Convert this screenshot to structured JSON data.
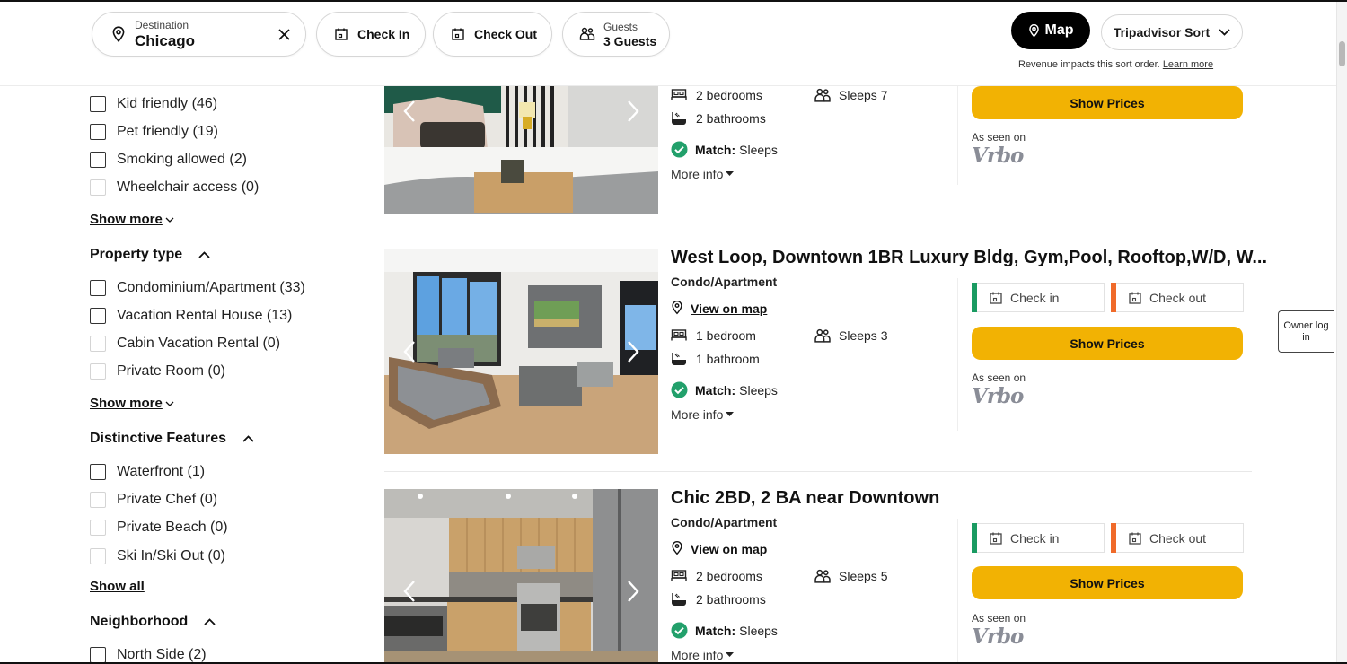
{
  "search": {
    "destination_label": "Destination",
    "destination_value": "Chicago",
    "check_in_label": "Check In",
    "check_out_label": "Check Out",
    "guests_label": "Guests",
    "guests_value": "3 Guests"
  },
  "toolbar": {
    "map_label": "Map",
    "sort_label": "Tripadvisor Sort",
    "revenue_note": "Revenue impacts this sort order.",
    "learn_more": "Learn more"
  },
  "filters": {
    "amenities": [
      {
        "label": "Kid friendly (46)",
        "enabled": true
      },
      {
        "label": "Pet friendly (19)",
        "enabled": true
      },
      {
        "label": "Smoking allowed (2)",
        "enabled": true
      },
      {
        "label": "Wheelchair access (0)",
        "enabled": false
      }
    ],
    "amenities_more": "Show more",
    "property_type": {
      "heading": "Property type",
      "items": [
        {
          "label": "Condominium/Apartment (33)",
          "enabled": true
        },
        {
          "label": "Vacation Rental House (13)",
          "enabled": true
        },
        {
          "label": "Cabin Vacation Rental (0)",
          "enabled": false
        },
        {
          "label": "Private Room (0)",
          "enabled": false
        }
      ],
      "more": "Show more"
    },
    "distinctive_features": {
      "heading": "Distinctive Features",
      "items": [
        {
          "label": "Waterfront (1)",
          "enabled": true
        },
        {
          "label": "Private Chef (0)",
          "enabled": false
        },
        {
          "label": "Private Beach (0)",
          "enabled": false
        },
        {
          "label": "Ski In/Ski Out (0)",
          "enabled": false
        }
      ],
      "more": "Show all"
    },
    "neighborhood": {
      "heading": "Neighborhood",
      "items": [
        {
          "label": "North Side (2)",
          "enabled": true
        }
      ]
    }
  },
  "listings": [
    {
      "title": "",
      "bedrooms": "2 bedrooms",
      "bathrooms": "2 bathrooms",
      "sleeps": "Sleeps 7",
      "match_label": "Match:",
      "match_value": "Sleeps",
      "more_info": "More info",
      "show_prices": "Show Prices",
      "seen_on": "As seen on",
      "source": "Vrbo"
    },
    {
      "title": "West Loop, Downtown 1BR Luxury Bldg, Gym,Pool, Rooftop,W/D, W...",
      "property_type": "Condo/Apartment",
      "view_on_map": "View on map",
      "bedrooms": "1 bedroom",
      "bathrooms": "1 bathroom",
      "sleeps": "Sleeps 3",
      "match_label": "Match:",
      "match_value": "Sleeps",
      "more_info": "More info",
      "check_in": "Check in",
      "check_out": "Check out",
      "show_prices": "Show Prices",
      "seen_on": "As seen on",
      "source": "Vrbo"
    },
    {
      "title": "Chic 2BD, 2 BA near Downtown",
      "property_type": "Condo/Apartment",
      "view_on_map": "View on map",
      "bedrooms": "2 bedrooms",
      "bathrooms": "2 bathrooms",
      "sleeps": "Sleeps 5",
      "match_label": "Match:",
      "match_value": "Sleeps",
      "more_info": "More info",
      "check_in": "Check in",
      "check_out": "Check out",
      "show_prices": "Show Prices",
      "seen_on": "As seen on",
      "source": "Vrbo"
    }
  ],
  "owner_login": "Owner log in",
  "colors": {
    "show_prices_bg": "#f2b203",
    "check_in_bar": "#1a9b62",
    "check_out_bar": "#f06a2a",
    "match_check": "#22a06b",
    "map_button_bg": "#000000"
  }
}
